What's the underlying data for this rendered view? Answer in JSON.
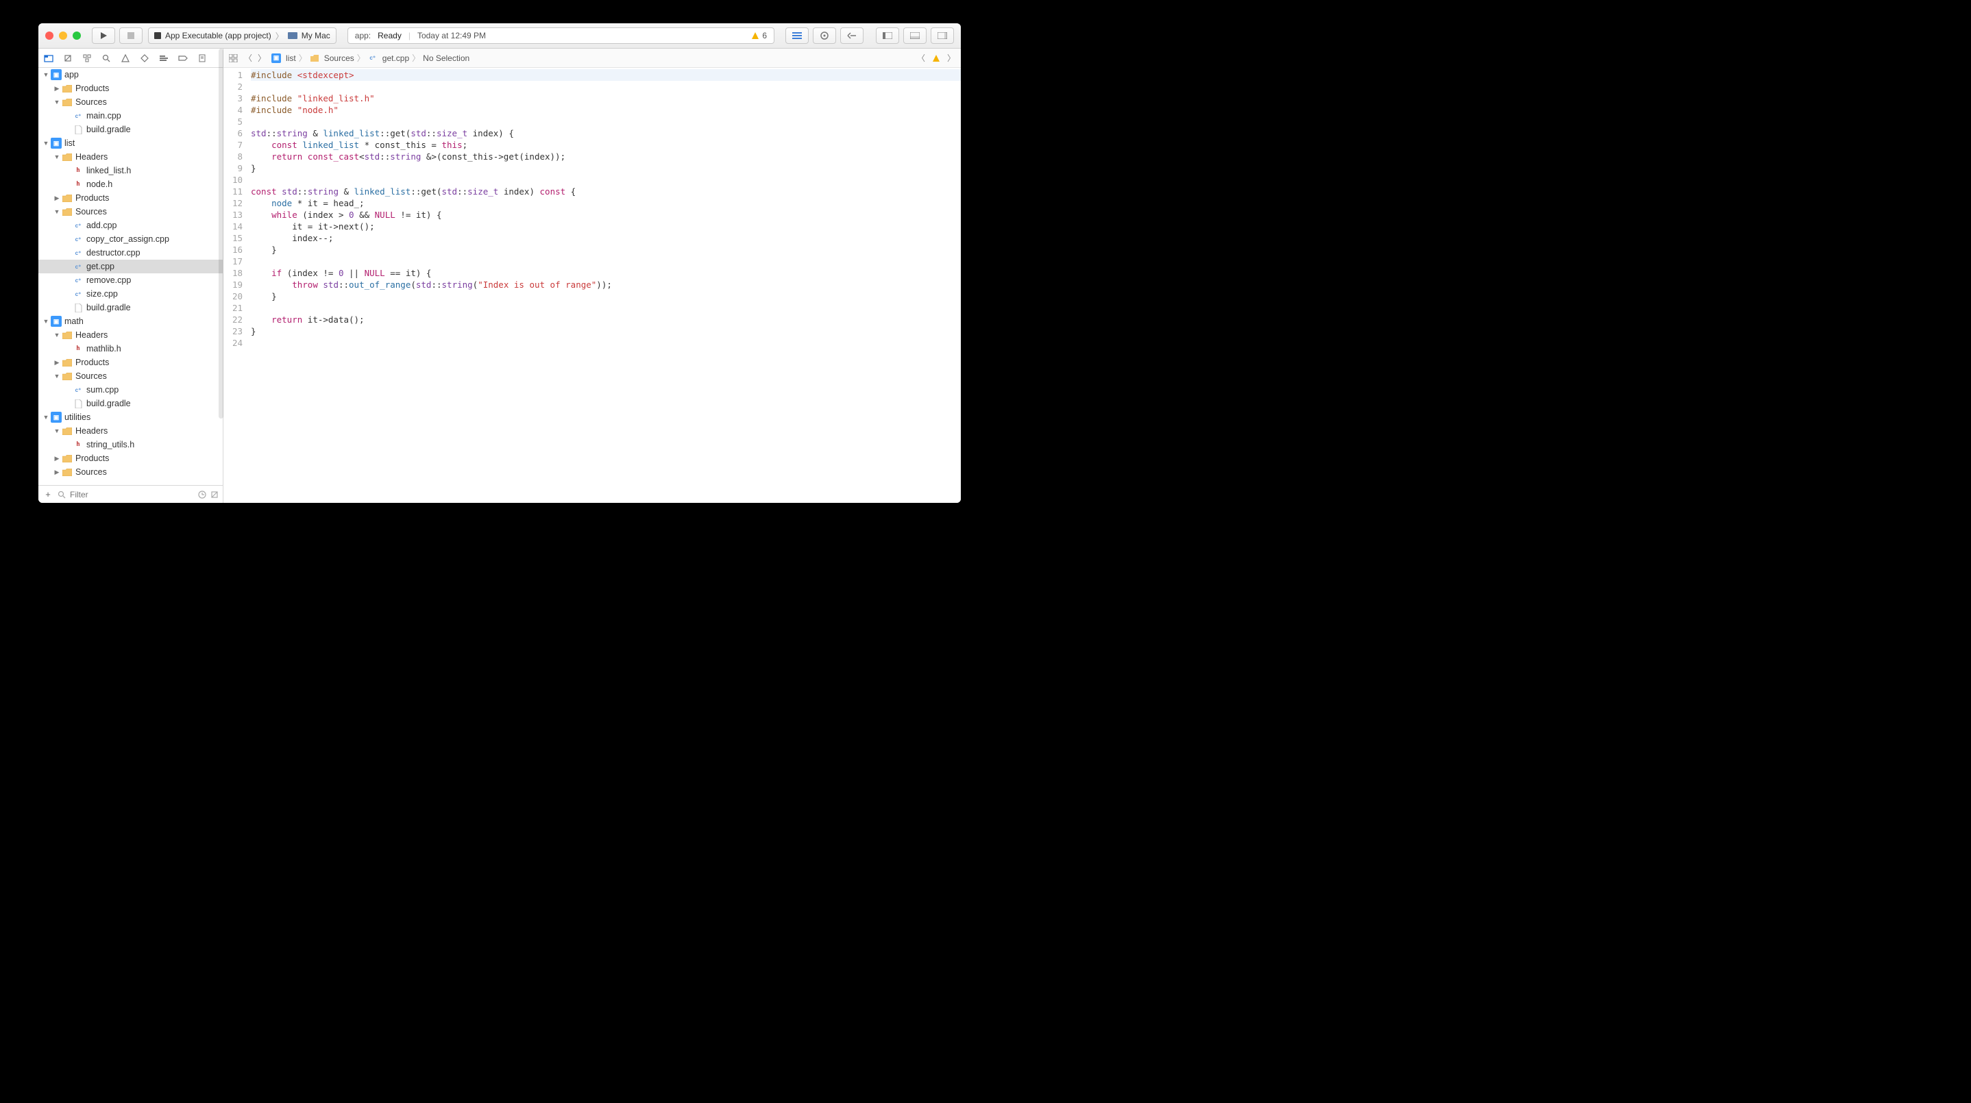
{
  "toolbar": {
    "scheme_name": "App Executable (app project)",
    "destination": "My Mac",
    "activity_app": "app:",
    "activity_status": "Ready",
    "activity_time": "Today at 12:49 PM",
    "warning_count": "6"
  },
  "filter": {
    "placeholder": "Filter"
  },
  "breadcrumb": {
    "items": [
      "list",
      "Sources",
      "get.cpp",
      "No Selection"
    ]
  },
  "tree": [
    {
      "d": 0,
      "open": true,
      "icon": "proj",
      "label": "app"
    },
    {
      "d": 1,
      "open": false,
      "icon": "folder",
      "label": "Products",
      "closed": true
    },
    {
      "d": 1,
      "open": true,
      "icon": "folder",
      "label": "Sources"
    },
    {
      "d": 2,
      "icon": "cpp",
      "label": "main.cpp"
    },
    {
      "d": 2,
      "icon": "file",
      "label": "build.gradle"
    },
    {
      "d": 0,
      "open": true,
      "icon": "proj",
      "label": "list"
    },
    {
      "d": 1,
      "open": true,
      "icon": "folder",
      "label": "Headers"
    },
    {
      "d": 2,
      "icon": "h",
      "label": "linked_list.h"
    },
    {
      "d": 2,
      "icon": "h",
      "label": "node.h"
    },
    {
      "d": 1,
      "open": false,
      "icon": "folder",
      "label": "Products",
      "closed": true
    },
    {
      "d": 1,
      "open": true,
      "icon": "folder",
      "label": "Sources"
    },
    {
      "d": 2,
      "icon": "cpp",
      "label": "add.cpp"
    },
    {
      "d": 2,
      "icon": "cpp",
      "label": "copy_ctor_assign.cpp"
    },
    {
      "d": 2,
      "icon": "cpp",
      "label": "destructor.cpp"
    },
    {
      "d": 2,
      "icon": "cpp",
      "label": "get.cpp",
      "sel": true
    },
    {
      "d": 2,
      "icon": "cpp",
      "label": "remove.cpp"
    },
    {
      "d": 2,
      "icon": "cpp",
      "label": "size.cpp"
    },
    {
      "d": 2,
      "icon": "file",
      "label": "build.gradle"
    },
    {
      "d": 0,
      "open": true,
      "icon": "proj",
      "label": "math"
    },
    {
      "d": 1,
      "open": true,
      "icon": "folder",
      "label": "Headers"
    },
    {
      "d": 2,
      "icon": "h",
      "label": "mathlib.h"
    },
    {
      "d": 1,
      "open": false,
      "icon": "folder",
      "label": "Products",
      "closed": true
    },
    {
      "d": 1,
      "open": true,
      "icon": "folder",
      "label": "Sources"
    },
    {
      "d": 2,
      "icon": "cpp",
      "label": "sum.cpp"
    },
    {
      "d": 2,
      "icon": "file",
      "label": "build.gradle"
    },
    {
      "d": 0,
      "open": true,
      "icon": "proj",
      "label": "utilities"
    },
    {
      "d": 1,
      "open": true,
      "icon": "folder",
      "label": "Headers"
    },
    {
      "d": 2,
      "icon": "h",
      "label": "string_utils.h"
    },
    {
      "d": 1,
      "open": false,
      "icon": "folder",
      "label": "Products",
      "closed": true
    },
    {
      "d": 1,
      "open": false,
      "icon": "folder",
      "label": "Sources",
      "closed": true
    }
  ],
  "code": {
    "lines": [
      [
        {
          "c": "pp",
          "t": "#include "
        },
        {
          "c": "str",
          "t": "<stdexcept>"
        }
      ],
      [],
      [
        {
          "c": "pp",
          "t": "#include "
        },
        {
          "c": "str",
          "t": "\"linked_list.h\""
        }
      ],
      [
        {
          "c": "pp",
          "t": "#include "
        },
        {
          "c": "str",
          "t": "\"node.h\""
        }
      ],
      [],
      [
        {
          "c": "ty",
          "t": "std"
        },
        {
          "t": "::"
        },
        {
          "c": "ty",
          "t": "string"
        },
        {
          "t": " & "
        },
        {
          "c": "fn",
          "t": "linked_list"
        },
        {
          "t": "::get("
        },
        {
          "c": "ty",
          "t": "std"
        },
        {
          "t": "::"
        },
        {
          "c": "ty",
          "t": "size_t"
        },
        {
          "t": " index) {"
        }
      ],
      [
        {
          "t": "    "
        },
        {
          "c": "kw",
          "t": "const"
        },
        {
          "t": " "
        },
        {
          "c": "fn",
          "t": "linked_list"
        },
        {
          "t": " * const_this = "
        },
        {
          "c": "kw",
          "t": "this"
        },
        {
          "t": ";"
        }
      ],
      [
        {
          "t": "    "
        },
        {
          "c": "kw",
          "t": "return"
        },
        {
          "t": " "
        },
        {
          "c": "kw",
          "t": "const_cast"
        },
        {
          "t": "<"
        },
        {
          "c": "ty",
          "t": "std"
        },
        {
          "t": "::"
        },
        {
          "c": "ty",
          "t": "string"
        },
        {
          "t": " &>(const_this->get(index));"
        }
      ],
      [
        {
          "t": "}"
        }
      ],
      [],
      [
        {
          "c": "kw",
          "t": "const"
        },
        {
          "t": " "
        },
        {
          "c": "ty",
          "t": "std"
        },
        {
          "t": "::"
        },
        {
          "c": "ty",
          "t": "string"
        },
        {
          "t": " & "
        },
        {
          "c": "fn",
          "t": "linked_list"
        },
        {
          "t": "::get("
        },
        {
          "c": "ty",
          "t": "std"
        },
        {
          "t": "::"
        },
        {
          "c": "ty",
          "t": "size_t"
        },
        {
          "t": " index) "
        },
        {
          "c": "kw",
          "t": "const"
        },
        {
          "t": " {"
        }
      ],
      [
        {
          "t": "    "
        },
        {
          "c": "fn",
          "t": "node"
        },
        {
          "t": " * it = head_;"
        }
      ],
      [
        {
          "t": "    "
        },
        {
          "c": "kw",
          "t": "while"
        },
        {
          "t": " (index > "
        },
        {
          "c": "ty",
          "t": "0"
        },
        {
          "t": " && "
        },
        {
          "c": "kw",
          "t": "NULL"
        },
        {
          "t": " != it) {"
        }
      ],
      [
        {
          "t": "        it = it->next();"
        }
      ],
      [
        {
          "t": "        index--;"
        }
      ],
      [
        {
          "t": "    }"
        }
      ],
      [],
      [
        {
          "t": "    "
        },
        {
          "c": "kw",
          "t": "if"
        },
        {
          "t": " (index != "
        },
        {
          "c": "ty",
          "t": "0"
        },
        {
          "t": " || "
        },
        {
          "c": "kw",
          "t": "NULL"
        },
        {
          "t": " == it) {"
        }
      ],
      [
        {
          "t": "        "
        },
        {
          "c": "kw",
          "t": "throw"
        },
        {
          "t": " "
        },
        {
          "c": "ty",
          "t": "std"
        },
        {
          "t": "::"
        },
        {
          "c": "fn",
          "t": "out_of_range"
        },
        {
          "t": "("
        },
        {
          "c": "ty",
          "t": "std"
        },
        {
          "t": "::"
        },
        {
          "c": "ty",
          "t": "string"
        },
        {
          "t": "("
        },
        {
          "c": "str",
          "t": "\"Index is out of range\""
        },
        {
          "t": "));"
        }
      ],
      [
        {
          "t": "    }"
        }
      ],
      [],
      [
        {
          "t": "    "
        },
        {
          "c": "kw",
          "t": "return"
        },
        {
          "t": " it->data();"
        }
      ],
      [
        {
          "t": "}"
        }
      ],
      []
    ],
    "highlight_line": 1
  }
}
